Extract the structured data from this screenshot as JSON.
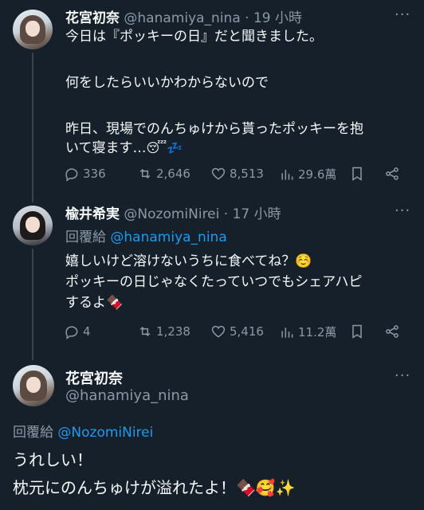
{
  "tweets": [
    {
      "name": "花宮初奈",
      "handle": "@hanamiya_nina",
      "time": "19 小時",
      "lines": [
        "今日は『ポッキーの日』だと聞きました。",
        "",
        "何をしたらいいかわからないので",
        "",
        "昨日、現場でのんちゅけから貰ったポッキーを抱",
        "いて寝ます…"
      ],
      "emoji_tail": "😴💤",
      "stats": {
        "replies": "336",
        "retweets": "2,646",
        "likes": "8,513",
        "views": "29.6萬"
      }
    },
    {
      "name": "楡井希実",
      "handle": "@NozomiNirei",
      "time": "17 小時",
      "reply_prefix": "回覆給",
      "reply_to": "@hanamiya_nina",
      "lines": [
        "嬉しいけど溶けないうちに食べてね？☺️",
        "ポッキーの日じゃなくたっていつでもシェアハピ",
        "するよ🍫"
      ],
      "stats": {
        "replies": "4",
        "retweets": "1,238",
        "likes": "5,416",
        "views": "11.2萬"
      }
    }
  ],
  "focused": {
    "name": "花宮初奈",
    "handle": "@hanamiya_nina",
    "reply_prefix": "回覆給",
    "reply_to": "@NozomiNirei",
    "lines": [
      "うれしい！",
      "枕元にのんちゅけが溢れたよ！🍫🥰✨"
    ]
  },
  "labels": {
    "dot": "·",
    "more": "···"
  },
  "colors": {
    "background": "#15202b",
    "link": "#1d9bf0",
    "muted": "#8b98a5",
    "text": "#f7f9f9"
  },
  "icons": [
    "reply-icon",
    "retweet-icon",
    "like-icon",
    "views-icon",
    "bookmark-icon",
    "share-icon",
    "more-icon"
  ]
}
